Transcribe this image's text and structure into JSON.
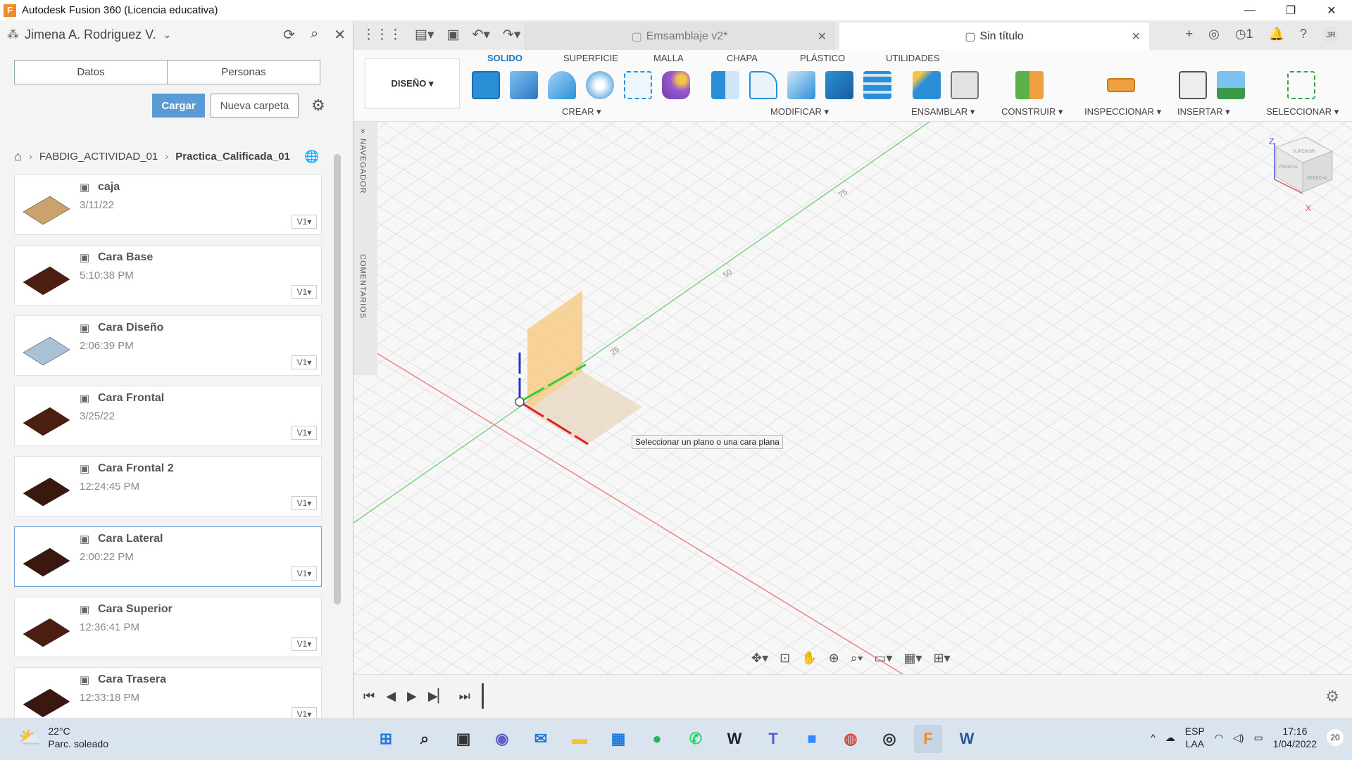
{
  "window": {
    "logo": "F",
    "title": "Autodesk Fusion 360 (Licencia educativa)",
    "minimize": "—",
    "restore": "❐",
    "close": "✕"
  },
  "datapanel": {
    "user_icon": "⁂",
    "user_name": "Jimena A. Rodriguez V.",
    "user_chevron": "⌄",
    "refresh": "⟳",
    "search": "⌕",
    "close": "✕",
    "tabs": [
      "Datos",
      "Personas"
    ],
    "upload_label": "Cargar",
    "new_folder_label": "Nueva carpeta",
    "settings": "⚙",
    "breadcrumb": {
      "home": "⌂",
      "project": "FABDIG_ACTIVIDAD_01",
      "folder": "Practica_Calificada_01",
      "globe": "🌐"
    },
    "files": [
      {
        "name": "caja",
        "date": "3/11/22",
        "version": "V1▾",
        "thumb_color": "#c9a36b"
      },
      {
        "name": "Cara Base",
        "date": "5:10:38 PM",
        "version": "V1▾",
        "thumb_color": "#4a1f12"
      },
      {
        "name": "Cara Diseño",
        "date": "2:06:39 PM",
        "version": "V1▾",
        "thumb_color": "#a9c0d6"
      },
      {
        "name": "Cara Frontal",
        "date": "3/25/22",
        "version": "V1▾",
        "thumb_color": "#4a1f12"
      },
      {
        "name": "Cara Frontal 2",
        "date": "12:24:45 PM",
        "version": "V1▾",
        "thumb_color": "#3a1810"
      },
      {
        "name": "Cara Lateral",
        "date": "2:00:22 PM",
        "version": "V1▾",
        "thumb_color": "#3a1810"
      },
      {
        "name": "Cara Superior",
        "date": "12:36:41 PM",
        "version": "V1▾",
        "thumb_color": "#4a1f12"
      },
      {
        "name": "Cara Trasera",
        "date": "12:33:18 PM",
        "version": "V1▾",
        "thumb_color": "#3a1810"
      }
    ]
  },
  "tabstrip": {
    "grid": "⋮⋮⋮",
    "file": "▤▾",
    "save": "▣",
    "undo": "↶▾",
    "redo": "↷▾",
    "tabs": [
      {
        "label": "Emsamblaje v2*",
        "close": "✕"
      },
      {
        "label": "Sin título",
        "close": "✕"
      }
    ],
    "new_tab": "+",
    "extensions": "◎",
    "jobs": "◷1",
    "notifications": "🔔",
    "help": "?",
    "avatar": "JR"
  },
  "toolbar": {
    "workspace": "DISEÑO ▾",
    "tabs": [
      "SOLIDO",
      "SUPERFICIE",
      "MALLA",
      "CHAPA",
      "PLÁSTICO",
      "UTILIDADES"
    ],
    "groups": [
      "CREAR ▾",
      "MODIFICAR ▾",
      "ENSAMBLAR ▾",
      "CONSTRUIR ▾",
      "INSPECCIONAR ▾",
      "INSERTAR ▾",
      "SELECCIONAR ▾"
    ],
    "colors": {
      "blue": "#2b8fd8",
      "active_tab": "#1a78c2",
      "green": "#5bb04a",
      "orange": "#f0a040",
      "purple": "#9b59d0"
    }
  },
  "viewport": {
    "navigator_label": "NAVEGADOR",
    "navigator_toggle": "»",
    "comments_label": "COMENTARIOS",
    "tooltip": "Seleccionar un plano o una cara plana",
    "axis_ticks": [
      "25",
      "50",
      "75"
    ],
    "viewcube": {
      "top": "SUPERIOR",
      "front": "FRONTAL",
      "right": "DERECHA",
      "z": "Z",
      "x": "X"
    },
    "nav_tools": [
      "✥▾",
      "⊡",
      "✋",
      "⊕",
      "⌕▾",
      "▭▾",
      "▦▾",
      "⊞▾"
    ]
  },
  "timeline": {
    "controls": [
      "⏮",
      "◀",
      "▶",
      "▶▏",
      "⏭"
    ],
    "settings": "⚙"
  },
  "taskbar": {
    "weather_icon": "⛅",
    "temperature": "22°C",
    "condition": "Parc. soleado",
    "apps": [
      {
        "name": "start",
        "glyph": "⊞",
        "color": "#1e78d7"
      },
      {
        "name": "search",
        "glyph": "⌕",
        "color": "#222222"
      },
      {
        "name": "task-view",
        "glyph": "▣",
        "color": "#333333"
      },
      {
        "name": "chat",
        "glyph": "◉",
        "color": "#5b5fc7"
      },
      {
        "name": "mail",
        "glyph": "✉",
        "color": "#1e78d7"
      },
      {
        "name": "file-explorer",
        "glyph": "▬",
        "color": "#f2c230"
      },
      {
        "name": "store",
        "glyph": "▦",
        "color": "#1e78d7"
      },
      {
        "name": "spotify",
        "glyph": "●",
        "color": "#1db954"
      },
      {
        "name": "whatsapp",
        "glyph": "✆",
        "color": "#25d366"
      },
      {
        "name": "wattpad",
        "glyph": "W",
        "color": "#222222"
      },
      {
        "name": "teams",
        "glyph": "T",
        "color": "#5b5fc7"
      },
      {
        "name": "zoom",
        "glyph": "■",
        "color": "#2d8cff"
      },
      {
        "name": "chrome",
        "glyph": "◍",
        "color": "#db4437"
      },
      {
        "name": "app-dark",
        "glyph": "◎",
        "color": "#333333"
      },
      {
        "name": "fusion",
        "glyph": "F",
        "color": "#f08c2a"
      },
      {
        "name": "word",
        "glyph": "W",
        "color": "#2b579a"
      }
    ],
    "tray_chevron": "^",
    "cloud": "☁",
    "lang_top": "ESP",
    "lang_bottom": "LAA",
    "wifi": "◠",
    "volume": "◁)",
    "battery": "▭",
    "time": "17:16",
    "date": "1/04/2022",
    "notif_count": "20"
  }
}
